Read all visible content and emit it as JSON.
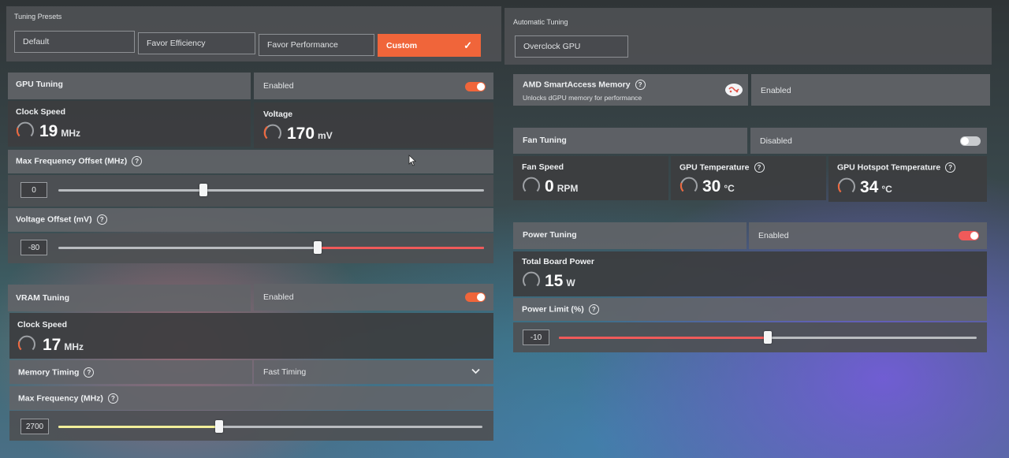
{
  "presets": {
    "title": "Tuning Presets",
    "default": "Default",
    "favor_efficiency": "Favor Efficiency",
    "favor_performance": "Favor Performance",
    "custom": "Custom",
    "check": "✓"
  },
  "auto_tuning": {
    "title": "Automatic Tuning",
    "overclock": "Overclock GPU"
  },
  "gpu_tuning": {
    "title": "GPU Tuning",
    "state": "Enabled",
    "enabled": true,
    "clock_label": "Clock Speed",
    "clock_value": "19",
    "clock_unit": "MHz",
    "voltage_label": "Voltage",
    "voltage_value": "170",
    "voltage_unit": "mV",
    "max_freq_label": "Max Frequency Offset (MHz)",
    "max_freq_value": "0",
    "max_freq_fraction": 0.34,
    "voltage_offset_label": "Voltage Offset (mV)",
    "voltage_offset_value": "-80",
    "voltage_offset_fraction": 0.61
  },
  "vram_tuning": {
    "title": "VRAM Tuning",
    "state": "Enabled",
    "enabled": true,
    "clock_label": "Clock Speed",
    "clock_value": "17",
    "clock_unit": "MHz",
    "memory_timing_label": "Memory Timing",
    "memory_timing_value": "Fast Timing",
    "max_freq_label": "Max Frequency (MHz)",
    "max_freq_value": "2700",
    "max_freq_fraction": 0.38
  },
  "smart_access": {
    "title": "AMD SmartAccess Memory",
    "subtitle": "Unlocks dGPU memory for performance",
    "state": "Enabled"
  },
  "fan_tuning": {
    "title": "Fan Tuning",
    "state": "Disabled",
    "enabled": false,
    "fan_speed_label": "Fan Speed",
    "fan_speed_value": "0",
    "fan_speed_unit": "RPM",
    "gpu_temp_label": "GPU Temperature",
    "gpu_temp_value": "30",
    "gpu_temp_unit": "°C",
    "hotspot_label": "GPU Hotspot Temperature",
    "hotspot_value": "34",
    "hotspot_unit": "°C"
  },
  "power_tuning": {
    "title": "Power Tuning",
    "state": "Enabled",
    "enabled": true,
    "board_power_label": "Total Board Power",
    "board_power_value": "15",
    "board_power_unit": "W",
    "power_limit_label": "Power Limit (%)",
    "power_limit_value": "-10",
    "power_limit_fraction": 0.5
  },
  "colors": {
    "accent": "#f0653a",
    "red_fill": "#f05a5a",
    "yellow_fill": "#f2ef9a"
  }
}
